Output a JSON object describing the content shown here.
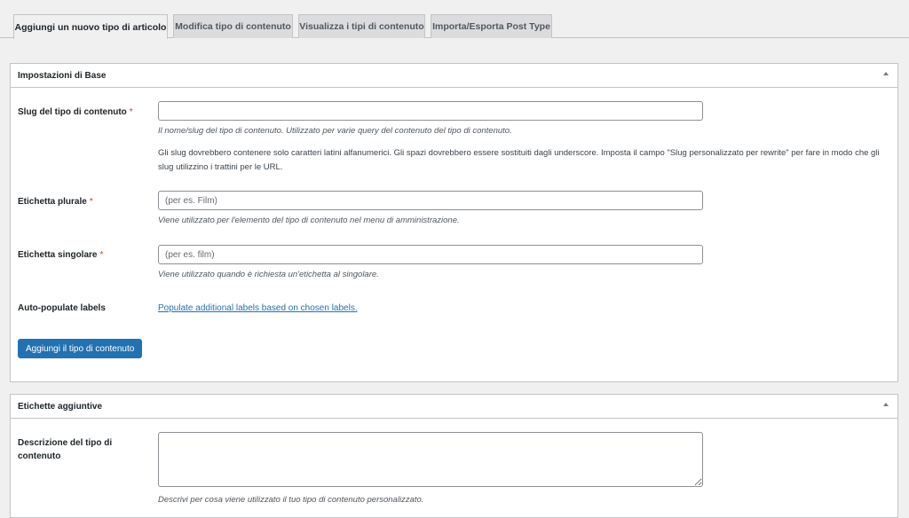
{
  "tabs": [
    {
      "label": "Aggiungi un nuovo tipo di articolo",
      "active": true
    },
    {
      "label": "Modifica tipo di contenuto",
      "active": false
    },
    {
      "label": "Visualizza i tipi di contenuto",
      "active": false
    },
    {
      "label": "Importa/Esporta Post Type",
      "active": false
    }
  ],
  "basic_settings": {
    "title": "Impostazioni di Base",
    "slug": {
      "label": "Slug del tipo di contenuto",
      "required_mark": "*",
      "value": "",
      "help": "Il nome/slug del tipo di contenuto. Utilizzato per varie query del contenuto del tipo di contenuto.",
      "note": "Gli slug dovrebbero contenere solo caratteri latini alfanumerici. Gli spazi dovrebbero essere sostituiti dagli underscore. Imposta il campo \"Slug personalizzato per rewrite\" per fare in modo che gli slug utilizzino i trattini per le URL."
    },
    "plural": {
      "label": "Etichetta plurale",
      "required_mark": "*",
      "placeholder": "(per es. Film)",
      "help": "Viene utilizzato per l'elemento del tipo di contenuto nel menu di amministrazione."
    },
    "singular": {
      "label": "Etichetta singolare",
      "required_mark": "*",
      "placeholder": "(per es. film)",
      "help": "Viene utilizzato quando è richiesta un'etichetta al singolare."
    },
    "auto_populate": {
      "label": "Auto-populate labels",
      "link": "Populate additional labels based on chosen labels."
    },
    "submit_label": "Aggiungi il tipo di contenuto"
  },
  "additional_labels": {
    "title": "Etichette aggiuntive",
    "description": {
      "label_line1": "Descrizione del tipo di",
      "label_line2": "contenuto",
      "value": "",
      "help": "Descrivi per cosa viene utilizzato il tuo tipo di contenuto personalizzato."
    }
  },
  "colors": {
    "primary": "#2271b1",
    "required": "#d63638",
    "background": "#f0f0f1"
  }
}
